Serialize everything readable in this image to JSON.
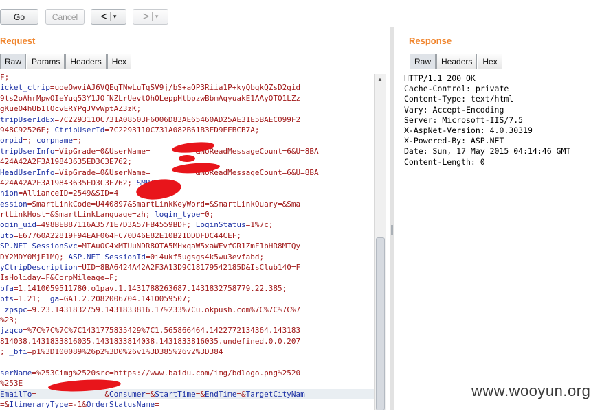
{
  "toolbar": {
    "go_label": "Go",
    "cancel_label": "Cancel",
    "back_arrow": "<",
    "forward_arrow": ">",
    "dropdown_glyph": "▾"
  },
  "request": {
    "title": "Request",
    "tabs": [
      {
        "label": "Raw",
        "active": true
      },
      {
        "label": "Params",
        "active": false
      },
      {
        "label": "Headers",
        "active": false
      },
      {
        "label": "Hex",
        "active": false
      }
    ],
    "lines": [
      [
        {
          "t": "F;",
          "k": 0
        }
      ],
      [
        {
          "t": "icket_ctrip",
          "k": 1
        },
        {
          "t": "=uoeOwviAJ6VQEgTNwLuTqSV9j/bS+aOP3Riia1P+kyQbgkQZsD2gid",
          "k": 0
        }
      ],
      [
        {
          "t": "9ts2oAhrMpwOIeYuq53Y1JOfNZLrUevtOhOLeppHtbpzwBbmAqyuakE1AAyOTO1LZz",
          "k": 0
        }
      ],
      [
        {
          "t": "gKueO4hUb1lOcvERYPqJVvWptAZ3zK;",
          "k": 0
        }
      ],
      [
        {
          "t": "tripUserIdEx",
          "k": 1
        },
        {
          "t": "=7C2293110C731A08503F6006D83AE65460AD25AE31E5BAEC099F2",
          "k": 0
        }
      ],
      [
        {
          "t": "948C92526E; ",
          "k": 0
        },
        {
          "t": "CtripUserId",
          "k": 1
        },
        {
          "t": "=7C2293110C731A082B61B3ED9EEBCB7A;",
          "k": 0
        }
      ],
      [
        {
          "t": "orpid",
          "k": 1
        },
        {
          "t": "=; ",
          "k": 0
        },
        {
          "t": "corpname",
          "k": 1
        },
        {
          "t": "=;",
          "k": 0
        }
      ],
      [
        {
          "t": "tripUserInfo",
          "k": 1
        },
        {
          "t": "=VipGrade=0&UserName=          &NoReadMessageCount=6&U=8BA",
          "k": 0
        }
      ],
      [
        {
          "t": "424A42A2F3A19843635ED3C3E762;",
          "k": 0
        }
      ],
      [
        {
          "t": "HeadUserInfo",
          "k": 1
        },
        {
          "t": "=VipGrade=0&UserName=          &NoReadMessageCount=6&U=8BA",
          "k": 0
        }
      ],
      [
        {
          "t": "424A42A2F3A19843635ED3C3E762; ",
          "k": 0
        },
        {
          "t": "SMBID",
          "k": 1
        },
        {
          "t": "=;",
          "k": 0
        }
      ],
      [
        {
          "t": "nion",
          "k": 1
        },
        {
          "t": "=AllianceID=2549&SID=4      UID=;",
          "k": 0
        }
      ],
      [
        {
          "t": "ession",
          "k": 1
        },
        {
          "t": "=SmartLinkCode=U440897&SmartLinkKeyWord=&SmartLinkQuary=&Sma",
          "k": 0
        }
      ],
      [
        {
          "t": "rtLinkHost=&SmartLinkLanguage=zh; ",
          "k": 0
        },
        {
          "t": "login_type",
          "k": 1
        },
        {
          "t": "=0;",
          "k": 0
        }
      ],
      [
        {
          "t": "ogin_uid",
          "k": 1
        },
        {
          "t": "=498BEB87116A3571E7D3A57FB4559BDF; ",
          "k": 0
        },
        {
          "t": "LoginStatus",
          "k": 1
        },
        {
          "t": "=1%7c;",
          "k": 0
        }
      ],
      [
        {
          "t": "uto",
          "k": 1
        },
        {
          "t": "=E67760A22819F94EAF064FC70D46E82E10B21DDDFDC44CEF;",
          "k": 0
        }
      ],
      [
        {
          "t": "SP.NET_SessionSvc",
          "k": 1
        },
        {
          "t": "=MTAuOC4xMTUuNDR8OTA5MHxqaW5xaWFvfGR1ZmF1bHR8MTQy",
          "k": 0
        }
      ],
      [
        {
          "t": "DY2MDY0MjE1MQ; ",
          "k": 0
        },
        {
          "t": "ASP.NET_SessionId",
          "k": 1
        },
        {
          "t": "=0i4ukf5ugsgs4k5wu3evfabd;",
          "k": 0
        }
      ],
      [
        {
          "t": "yCtripDescription",
          "k": 1
        },
        {
          "t": "=UID=8BA6424A42A2F3A13D9C18179542185D&IsClub140=F",
          "k": 0
        }
      ],
      [
        {
          "t": "IsHoliday=F&CorpMileage=F;",
          "k": 0
        }
      ],
      [
        {
          "t": "bfa",
          "k": 1
        },
        {
          "t": "=1.1410059511780.o1pav.1.1431788263687.1431832758779.22.385;",
          "k": 0
        }
      ],
      [
        {
          "t": "bfs",
          "k": 1
        },
        {
          "t": "=1.21; ",
          "k": 0
        },
        {
          "t": "_ga",
          "k": 1
        },
        {
          "t": "=GA1.2.2082006704.1410059507;",
          "k": 0
        }
      ],
      [
        {
          "t": "_zpspc",
          "k": 1
        },
        {
          "t": "=9.23.1431832759.1431833816.17%233%7Cu.okpush.com%7C%7C%7C%7",
          "k": 0
        }
      ],
      [
        {
          "t": "%23;",
          "k": 0
        }
      ],
      [
        {
          "t": "jzqco",
          "k": 1
        },
        {
          "t": "=%7C%7C%7C%7C1431775835429%7C1.565866464.1422772134364.143183",
          "k": 0
        }
      ],
      [
        {
          "t": "814038.1431833816035.1431833814038.1431833816035.undefined.0.0.207",
          "k": 0
        }
      ],
      [
        {
          "t": "; ",
          "k": 0
        },
        {
          "t": "_bfi",
          "k": 1
        },
        {
          "t": "=p1%3D100089%26p2%3D0%26v1%3D385%26v2%3D384",
          "k": 0
        }
      ],
      [
        {
          "t": "",
          "k": 0
        }
      ],
      [
        {
          "t": "serName",
          "k": 1
        },
        {
          "t": "=%253Cimg%2520src=https://www.baidu.com/img/bdlogo.png%2520",
          "k": 0
        }
      ],
      [
        {
          "t": "%253E",
          "k": 0
        }
      ],
      [
        {
          "t": "EmailTo",
          "k": 1
        },
        {
          "t": "=               &",
          "k": 0
        },
        {
          "t": "Consumer",
          "k": 1
        },
        {
          "t": "=&",
          "k": 0
        },
        {
          "t": "StartTime",
          "k": 1
        },
        {
          "t": "=&",
          "k": 0
        },
        {
          "t": "EndTime",
          "k": 1
        },
        {
          "t": "=&",
          "k": 0
        },
        {
          "t": "TargetCityNam",
          "k": 1
        }
      ],
      [
        {
          "t": "=&",
          "k": 0
        },
        {
          "t": "ItineraryType",
          "k": 1
        },
        {
          "t": "=-1&",
          "k": 0
        },
        {
          "t": "OrderStatusName",
          "k": 1
        },
        {
          "t": "=",
          "k": 0
        }
      ]
    ]
  },
  "response": {
    "title": "Response",
    "tabs": [
      {
        "label": "Raw",
        "active": true
      },
      {
        "label": "Headers",
        "active": false
      },
      {
        "label": "Hex",
        "active": false
      }
    ],
    "lines": [
      "HTTP/1.1 200 OK",
      "Cache-Control: private",
      "Content-Type: text/html",
      "Vary: Accept-Encoding",
      "Server: Microsoft-IIS/7.5",
      "X-AspNet-Version: 4.0.30319",
      "X-Powered-By: ASP.NET",
      "Date: Sun, 17 May 2015 04:14:46 GMT",
      "Content-Length: 0"
    ]
  },
  "watermark": "www.wooyun.org",
  "colors": {
    "pane_title": "#f0852d",
    "param_value": "#a01818",
    "param_key": "#1b2fa3",
    "redaction": "#e8151b"
  }
}
